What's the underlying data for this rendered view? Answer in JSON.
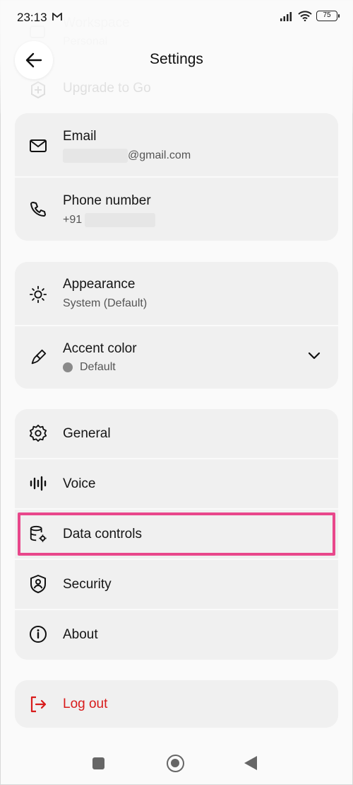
{
  "status_bar": {
    "time": "23:13",
    "battery": "75"
  },
  "header": {
    "title": "Settings"
  },
  "faded_items": [
    {
      "label": "Workspace",
      "sub": "Personal"
    },
    {
      "label": "Upgrade to Go"
    }
  ],
  "account": {
    "email_label": "Email",
    "email_value": "@gmail.com",
    "phone_label": "Phone number",
    "phone_value": "+91"
  },
  "display": {
    "appearance_label": "Appearance",
    "appearance_value": "System (Default)",
    "accent_label": "Accent color",
    "accent_value": "Default"
  },
  "menu": {
    "general": "General",
    "voice": "Voice",
    "data_controls": "Data controls",
    "security": "Security",
    "about": "About"
  },
  "logout": {
    "label": "Log out"
  },
  "colors": {
    "logout": "#d81b1b",
    "highlight": "#e8478b",
    "accent_dot": "#8a8a8a"
  }
}
